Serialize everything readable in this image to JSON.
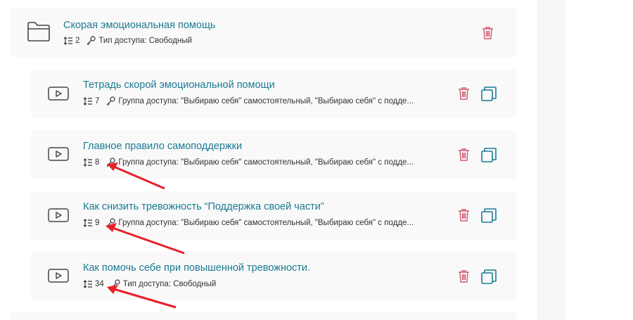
{
  "folder": {
    "title": "Скорая эмоциональная помощь",
    "lessons_count": "2",
    "access": "Тип доступа: Свободный"
  },
  "lessons": [
    {
      "title": "Тетрадь скорой эмоциональной помощи",
      "count": "7",
      "access": "Группа доступа: \"Выбираю себя\" самостоятельный, \"Выбираю себя\" с подде..."
    },
    {
      "title": "Главное правило самоподдержки",
      "count": "8",
      "access": "Группа доступа: \"Выбираю себя\" самостоятельный, \"Выбираю себя\" с подде..."
    },
    {
      "title": "Как снизить тревожность “Поддержка своей части”",
      "count": "9",
      "access": "Группа доступа: \"Выбираю себя\" самостоятельный, \"Выбираю себя\" с подде..."
    },
    {
      "title": "Как помочь себе при повышенной тревожности.",
      "count": "34",
      "access": "Тип доступа: Свободный"
    }
  ],
  "icons": {
    "folder": "folder-icon",
    "video": "video-icon",
    "order": "order-list-icon",
    "key": "key-icon",
    "delete": "trash-icon",
    "copy": "copy-icon"
  },
  "colors": {
    "title": "#1a7a93",
    "delete": "#d1586f",
    "copy": "#1a7a93",
    "annotation_arrow": "#e8202a",
    "card_background": "#f9f9f9"
  }
}
